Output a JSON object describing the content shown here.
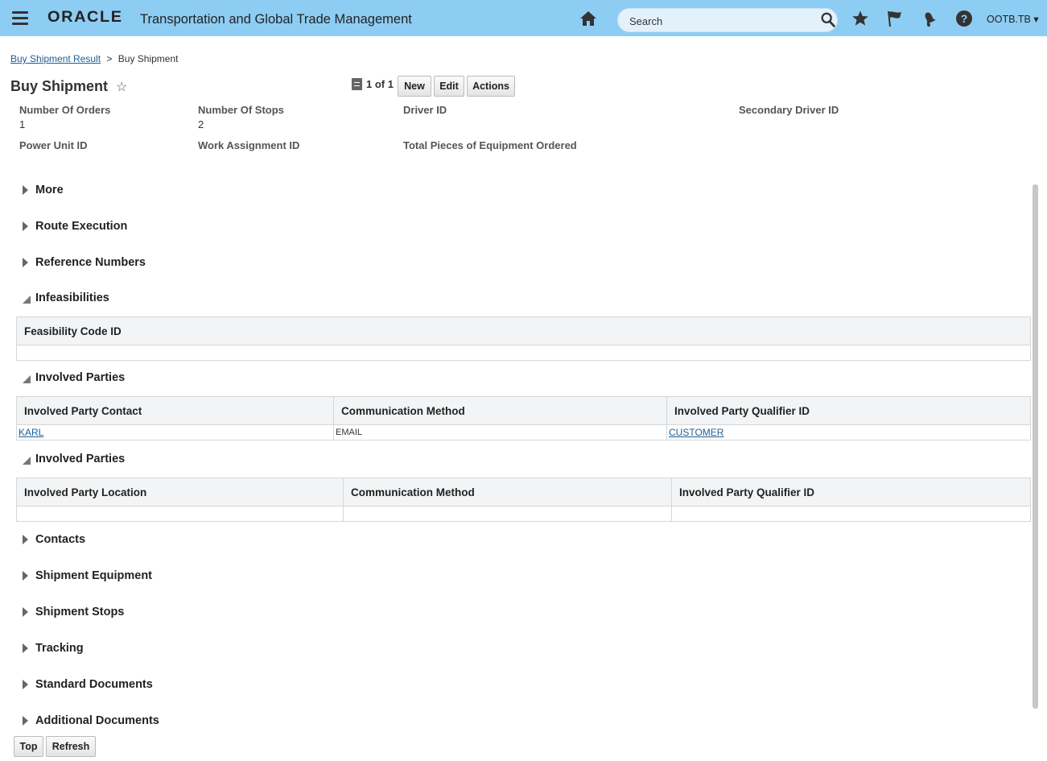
{
  "header": {
    "logo": "ORACLE",
    "app_title": "Transportation and Global Trade Management",
    "search_placeholder": "Search",
    "user": "OOTB.TB ▾"
  },
  "breadcrumb": {
    "parent": "Buy Shipment Result",
    "separator": ">",
    "current": "Buy Shipment"
  },
  "page": {
    "title": "Buy Shipment",
    "favorite_glyph": "☆",
    "record_count": "1 of 1",
    "buttons": {
      "new": "New",
      "edit": "Edit",
      "actions": "Actions"
    }
  },
  "fields": {
    "number_of_orders": {
      "label": "Number Of Orders",
      "value": "1"
    },
    "number_of_stops": {
      "label": "Number Of Stops",
      "value": "2"
    },
    "driver_id": {
      "label": "Driver ID"
    },
    "secondary_driver_id": {
      "label": "Secondary Driver ID"
    },
    "power_unit_id": {
      "label": "Power Unit ID"
    },
    "work_assignment_id": {
      "label": "Work Assignment ID"
    },
    "total_pieces": {
      "label": "Total Pieces of Equipment Ordered"
    }
  },
  "sections": {
    "more": "More",
    "route_execution": "Route Execution",
    "reference_numbers": "Reference Numbers",
    "infeasibilities": "Infeasibilities",
    "involved_parties_1": "Involved Parties",
    "involved_parties_2": "Involved Parties",
    "contacts": "Contacts",
    "shipment_equipment": "Shipment Equipment",
    "shipment_stops": "Shipment Stops",
    "tracking": "Tracking",
    "standard_documents": "Standard Documents",
    "additional_documents": "Additional Documents"
  },
  "tables": {
    "infeasibilities": {
      "headers": [
        "Feasibility Code ID"
      ]
    },
    "involved_contacts": {
      "headers": [
        "Involved Party Contact",
        "Communication Method",
        "Involved Party Qualifier ID"
      ],
      "row": {
        "contact": "KARL",
        "method": "EMAIL",
        "qualifier": "CUSTOMER"
      }
    },
    "involved_locations": {
      "headers": [
        "Involved Party Location",
        "Communication Method",
        "Involved Party Qualifier ID"
      ]
    }
  },
  "footer": {
    "top": "Top",
    "refresh": "Refresh"
  },
  "icons": {
    "menu": "hamburger-icon",
    "home": "home-icon",
    "search": "search-icon",
    "favorites": "star-icon",
    "flag": "flag-icon",
    "notifications": "bell-icon",
    "help": "help-icon"
  },
  "colors": {
    "header_bg": "#8ecdf3",
    "link": "#1f5e93"
  }
}
